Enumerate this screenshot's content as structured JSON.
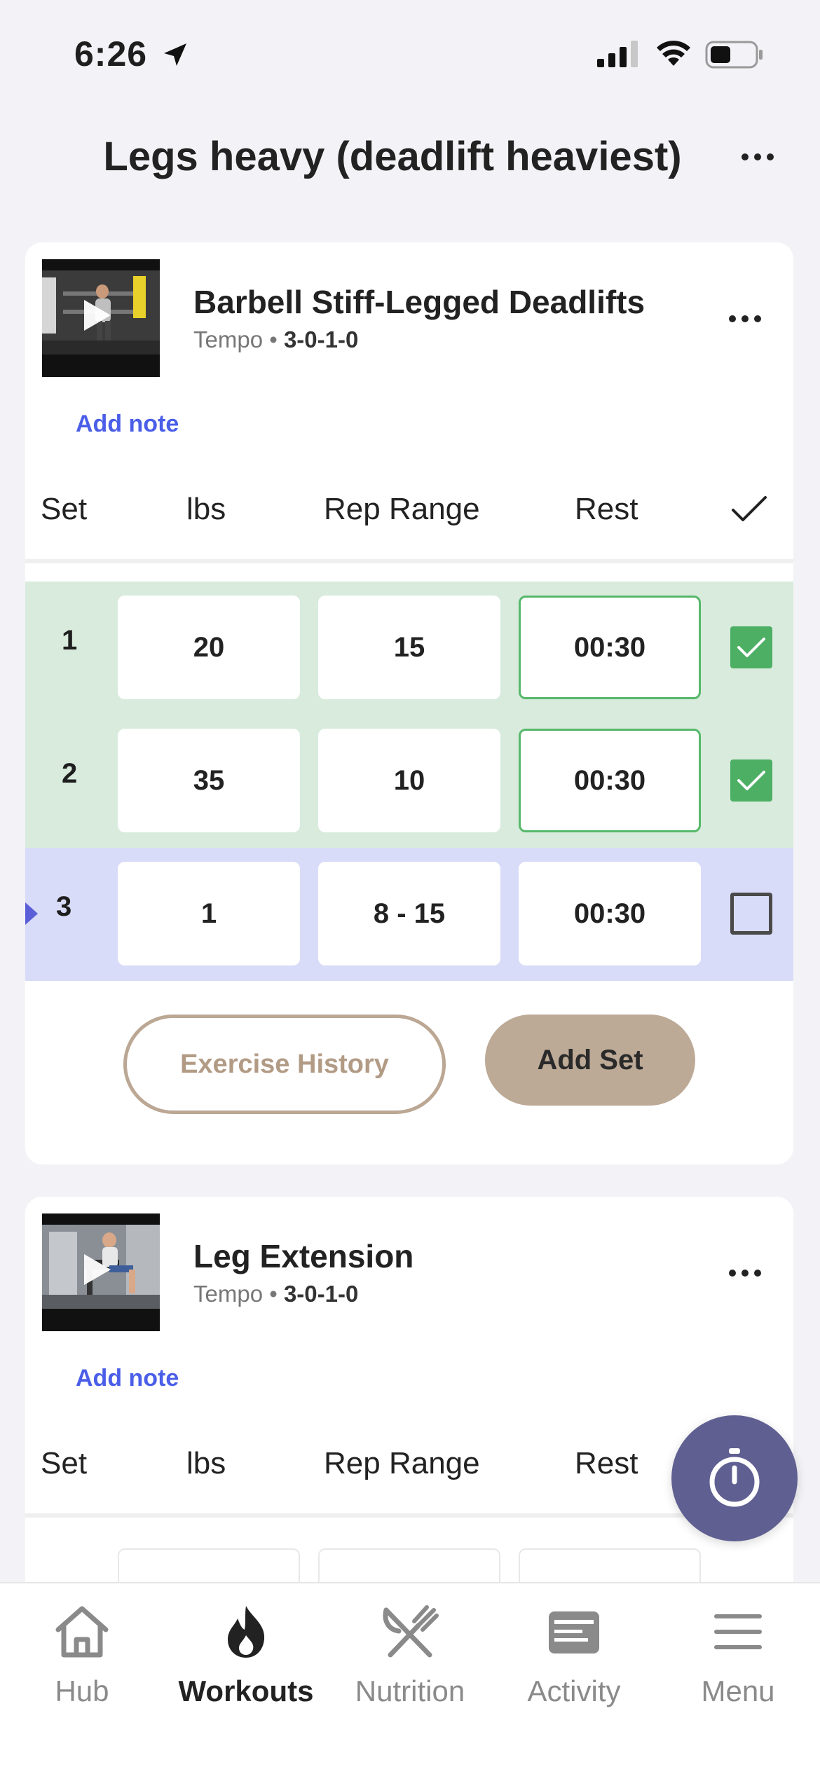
{
  "status_bar": {
    "time": "6:26"
  },
  "header": {
    "title": "Legs heavy (deadlift heaviest)"
  },
  "table_headers": {
    "set": "Set",
    "lbs": "lbs",
    "rep_range": "Rep Range",
    "rest": "Rest"
  },
  "exercises": [
    {
      "name": "Barbell Stiff-Legged Deadlifts",
      "tempo_label": "Tempo •",
      "tempo_value": "3-0-1-0",
      "add_note": "Add note",
      "sets": [
        {
          "num": "1",
          "lbs": "20",
          "reps": "15",
          "rest": "00:30",
          "completed": true
        },
        {
          "num": "2",
          "lbs": "35",
          "reps": "10",
          "rest": "00:30",
          "completed": true
        },
        {
          "num": "3",
          "lbs": "1",
          "reps": "8 - 15",
          "rest": "00:30",
          "completed": false
        }
      ],
      "history_button": "Exercise History",
      "add_set_button": "Add Set"
    },
    {
      "name": "Leg Extension",
      "tempo_label": "Tempo •",
      "tempo_value": "3-0-1-0",
      "add_note": "Add note"
    }
  ],
  "nav": {
    "items": [
      {
        "label": "Hub",
        "icon": "home-icon"
      },
      {
        "label": "Workouts",
        "icon": "flame-icon",
        "selected": true
      },
      {
        "label": "Nutrition",
        "icon": "fork-knife-icon"
      },
      {
        "label": "Activity",
        "icon": "activity-card-icon"
      },
      {
        "label": "Menu",
        "icon": "hamburger-menu-icon"
      }
    ]
  },
  "colors": {
    "completed_row": "#d8ebdd",
    "active_row": "#d9dcf8",
    "check_green": "#4caf64",
    "link_blue": "#4a5ee8",
    "accent_tan": "#bca996",
    "fab": "#5f5f92"
  }
}
